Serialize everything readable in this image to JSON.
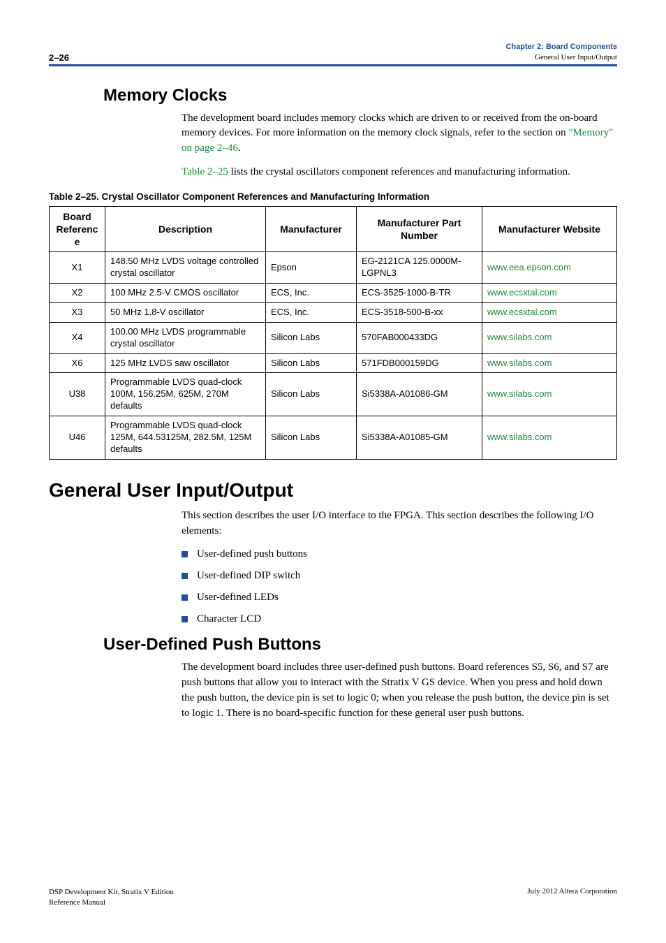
{
  "header": {
    "page_num": "2–26",
    "chapter_line1": "Chapter 2: Board Components",
    "chapter_line2": "General User Input/Output"
  },
  "memory_clocks": {
    "title": "Memory Clocks",
    "para1_pre": "The development board includes memory clocks which are driven to or received from the on-board memory devices. For more information on the memory clock signals, refer to the section on ",
    "para1_link": "\"Memory\" on page 2–46",
    "para1_post": ".",
    "para2_link": "Table 2–25",
    "para2_rest": " lists the crystal oscillators component references and manufacturing information."
  },
  "table_caption": "Table 2–25. Crystal Oscillator Component References and Manufacturing Information",
  "chart_data": {
    "type": "table",
    "headers": [
      "Board Reference",
      "Description",
      "Manufacturer",
      "Manufacturer Part Number",
      "Manufacturer Website"
    ],
    "rows": [
      {
        "ref": "X1",
        "desc": "148.50 MHz LVDS voltage controlled crystal oscillator",
        "mfr": "Epson",
        "part": "EG-2121CA 125.0000M-LGPNL3",
        "site": "www.eea.epson.com"
      },
      {
        "ref": "X2",
        "desc": "100 MHz 2.5-V CMOS oscillator",
        "mfr": "ECS, Inc.",
        "part": "ECS-3525-1000-B-TR",
        "site": "www.ecsxtal.com"
      },
      {
        "ref": "X3",
        "desc": "50 MHz 1.8-V oscillator",
        "mfr": "ECS, Inc.",
        "part": "ECS-3518-500-B-xx",
        "site": "www.ecsxtal.com"
      },
      {
        "ref": "X4",
        "desc": "100.00 MHz LVDS programmable crystal oscillator",
        "mfr": "Silicon Labs",
        "part": "570FAB000433DG",
        "site": "www.silabs.com"
      },
      {
        "ref": "X6",
        "desc": "125 MHz LVDS saw oscillator",
        "mfr": "Silicon Labs",
        "part": "571FDB000159DG",
        "site": "www.silabs.com"
      },
      {
        "ref": "U38",
        "desc": "Programmable LVDS quad-clock 100M, 156.25M, 625M, 270M defaults",
        "mfr": "Silicon Labs",
        "part": "Si5338A-A01086-GM",
        "site": "www.silabs.com"
      },
      {
        "ref": "U46",
        "desc": "Programmable LVDS quad-clock 125M, 644.53125M, 282.5M, 125M defaults",
        "mfr": "Silicon Labs",
        "part": "Si5338A-A01085-GM",
        "site": "www.silabs.com"
      }
    ]
  },
  "guio": {
    "title": "General User Input/Output",
    "intro": "This section describes the user I/O interface to the FPGA. This section describes the following I/O elements:",
    "bullets": [
      "User-defined push buttons",
      "User-defined DIP switch",
      "User-defined LEDs",
      "Character LCD"
    ]
  },
  "push_buttons": {
    "title": "User-Defined Push Buttons",
    "para": "The development board includes three user-defined push buttons. Board references S5, S6, and S7 are push buttons that allow you to interact with the Stratix V GS device. When you press and hold down the push button, the device pin is set to logic 0; when you release the push button, the device pin is set to logic 1. There is no board-specific function for these general user push buttons."
  },
  "footer": {
    "doc_title": "DSP Development Kit, Stratix V Edition",
    "doc_sub": "Reference Manual",
    "right": "July 2012   Altera Corporation"
  }
}
